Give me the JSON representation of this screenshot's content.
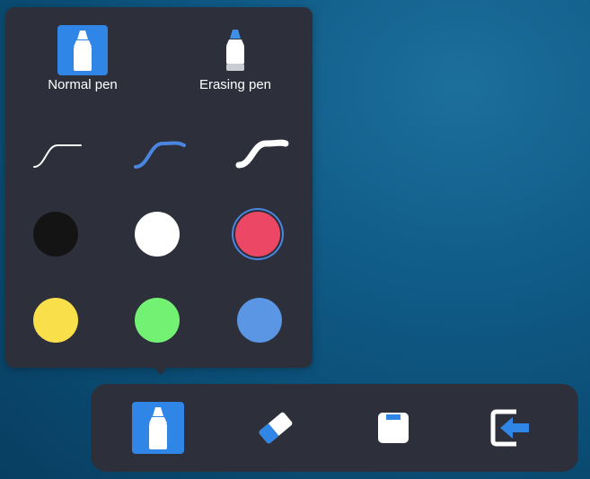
{
  "pen_modes": [
    {
      "label": "Normal pen",
      "icon": "marker-pen-icon",
      "selected": true
    },
    {
      "label": "Erasing pen",
      "icon": "erasing-pen-icon",
      "selected": false
    }
  ],
  "stroke_widths": [
    {
      "name": "thin",
      "color": "#ffffff"
    },
    {
      "name": "medium",
      "color": "#4a86e0",
      "selected": true
    },
    {
      "name": "thick",
      "color": "#ffffff"
    }
  ],
  "colors": [
    {
      "name": "black",
      "hex": "#141414"
    },
    {
      "name": "white",
      "hex": "#ffffff"
    },
    {
      "name": "red",
      "hex": "#ec4866",
      "selected": true
    },
    {
      "name": "yellow",
      "hex": "#f9e04a"
    },
    {
      "name": "green",
      "hex": "#73f173"
    },
    {
      "name": "blue",
      "hex": "#5b96e4"
    }
  ],
  "toolbar": [
    {
      "name": "pen-tool",
      "icon": "marker-pen-icon",
      "selected": true
    },
    {
      "name": "eraser-tool",
      "icon": "eraser-icon",
      "selected": false
    },
    {
      "name": "save-tool",
      "icon": "floppy-disk-icon",
      "selected": false
    },
    {
      "name": "exit-tool",
      "icon": "exit-arrow-icon",
      "selected": false
    }
  ],
  "theme": {
    "panel_bg": "#2d2f3b",
    "accent": "#2f86e6"
  }
}
